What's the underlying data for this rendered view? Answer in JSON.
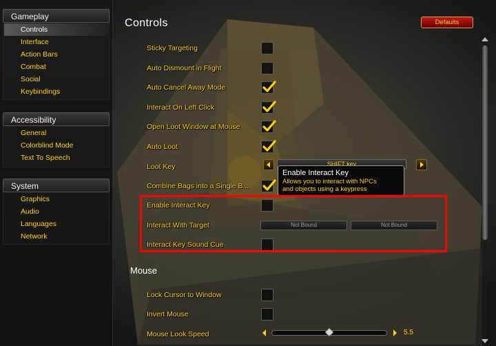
{
  "sidebar": {
    "categories": [
      {
        "title": "Gameplay",
        "items": [
          "Controls",
          "Interface",
          "Action Bars",
          "Combat",
          "Social",
          "Keybindings"
        ]
      },
      {
        "title": "Accessibility",
        "items": [
          "General",
          "Colorblind Mode",
          "Text To Speech"
        ]
      },
      {
        "title": "System",
        "items": [
          "Graphics",
          "Audio",
          "Languages",
          "Network"
        ]
      }
    ],
    "selected_item": "Controls"
  },
  "main": {
    "title": "Controls",
    "defaults_label": "Defaults",
    "options": [
      {
        "label": "Sticky Targeting",
        "checked": false
      },
      {
        "label": "Auto Dismount in Flight",
        "checked": false
      },
      {
        "label": "Auto Cancel Away Mode",
        "checked": true
      },
      {
        "label": "Interact On Left Click",
        "checked": true
      },
      {
        "label": "Open Loot Window at Mouse",
        "checked": true
      },
      {
        "label": "Auto Loot",
        "checked": true
      },
      {
        "label": "Loot Key",
        "value": "SHIFT key"
      },
      {
        "label": "Combine Bags into a Single B...",
        "checked": true
      },
      {
        "label": "Enable Interact Key",
        "checked": false
      },
      {
        "label": "Interact With Target",
        "binding1": "Not Bound",
        "binding2": "Not Bound"
      },
      {
        "label": "Interact Key Sound Cue",
        "checked": false
      }
    ],
    "mouse_section": {
      "title": "Mouse",
      "options": [
        {
          "label": "Lock Cursor to Window",
          "checked": false
        },
        {
          "label": "Invert Mouse",
          "checked": false
        },
        {
          "label": "Mouse Look Speed",
          "value": "5.5",
          "fraction": 0.5
        }
      ]
    },
    "tooltip": {
      "title": "Enable Interact Key",
      "body_line1": "Allows you to interact with NPCs",
      "body_line2": "and objects using a keypress"
    }
  },
  "colors": {
    "label_gold": "#ffd100",
    "highlight_red": "#ff0000",
    "defaults_red": "#a80000"
  }
}
